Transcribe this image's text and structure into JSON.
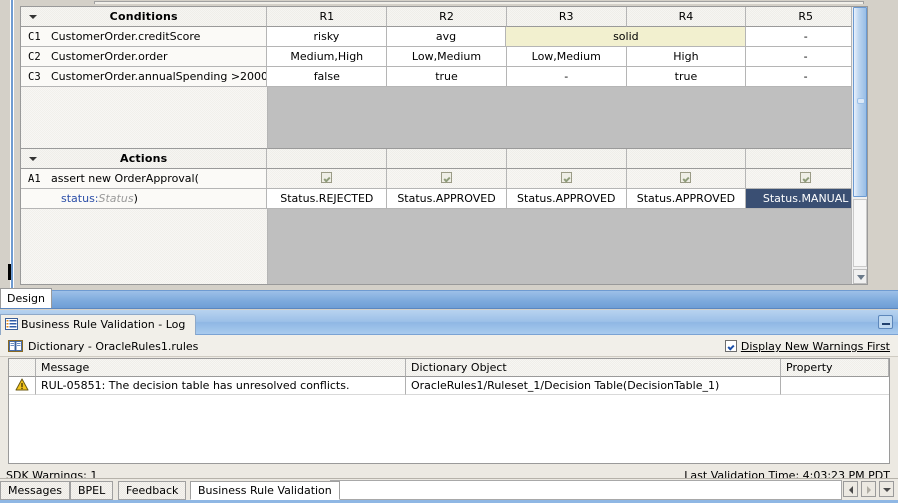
{
  "decision_table": {
    "conditions_header": "Conditions",
    "actions_header": "Actions",
    "rule_columns": [
      "R1",
      "R2",
      "R3",
      "R4",
      "R5"
    ],
    "conditions": [
      {
        "id": "C1",
        "expression": "CustomerOrder.creditScore",
        "values": [
          "risky",
          "avg",
          "solid",
          "-"
        ],
        "span_note": "solid spans R3 and R4",
        "highlight_color": "#f2f0cf"
      },
      {
        "id": "C2",
        "expression": "CustomerOrder.order",
        "values": [
          "Medium,High",
          "Low,Medium",
          "Low,Medium",
          "High",
          "-"
        ]
      },
      {
        "id": "C3",
        "expression": "CustomerOrder.annualSpending >2000",
        "values": [
          "false",
          "true",
          "-",
          "true",
          "-"
        ]
      }
    ],
    "actions": [
      {
        "id": "A1",
        "expression": "assert new OrderApproval(",
        "param_name": "status:",
        "param_type": "Status",
        "param_close": ")",
        "checkboxes": [
          true,
          true,
          true,
          true,
          true
        ],
        "values": [
          "Status.REJECTED",
          "Status.APPROVED",
          "Status.APPROVED",
          "Status.APPROVED",
          "Status.MANUAL"
        ],
        "selected_index": 4,
        "selected_color": "#3a4f73"
      }
    ]
  },
  "editor_tabs": {
    "design_label": "Design"
  },
  "log_panel": {
    "tab_title": "Business Rule Validation - Log",
    "dictionary_label": "Dictionary - OracleRules1.rules",
    "display_new_warnings_first": "Display New Warnings First",
    "display_new_warnings_first_checked": true,
    "columns": [
      "Message",
      "Dictionary Object",
      "Property"
    ],
    "rows": [
      {
        "severity": "warning",
        "message": "RUL-05851: The decision table has unresolved conflicts.",
        "dictionary_object": "OracleRules1/Ruleset_1/Decision Table(DecisionTable_1)",
        "property": ""
      }
    ],
    "sdk_warnings": "SDK Warnings: 1",
    "last_validation_time": "Last Validation Time: 4:03:23 PM PDT"
  },
  "bottom_tabs": {
    "items": [
      "Messages",
      "BPEL",
      "Feedback",
      "Business Rule Validation"
    ],
    "active_index": 3
  }
}
